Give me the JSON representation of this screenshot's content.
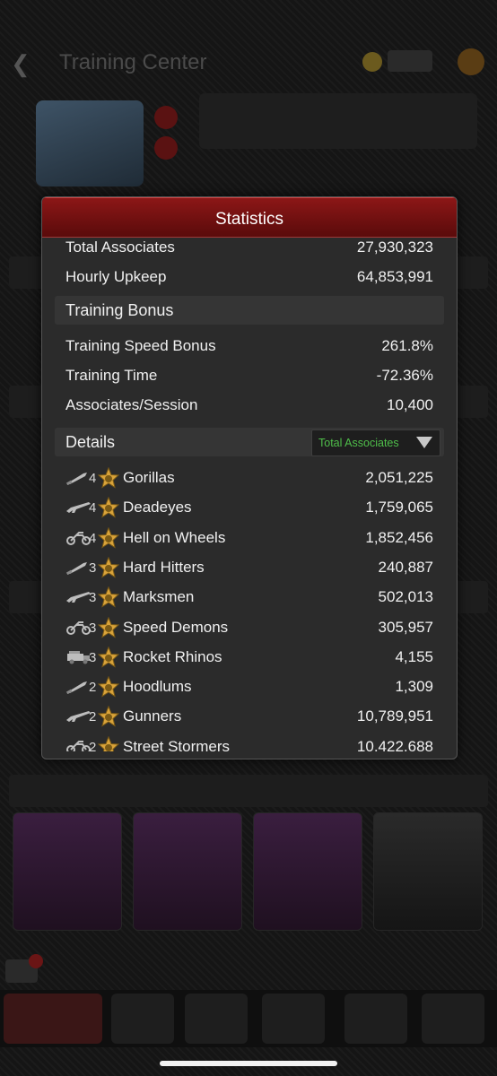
{
  "modal": {
    "title": "Statistics",
    "rows": [
      {
        "label": "Total Associates",
        "value": "27,930,323"
      },
      {
        "label": "Hourly Upkeep",
        "value": "64,853,991"
      }
    ],
    "training_bonus": {
      "title": "Training Bonus",
      "rows": [
        {
          "label": "Training Speed Bonus",
          "value": "261.8%"
        },
        {
          "label": "Training Time",
          "value": "-72.36%"
        },
        {
          "label": "Associates/Session",
          "value": "10,400"
        }
      ]
    },
    "details": {
      "title": "Details",
      "dropdown_selected": "Total Associates",
      "units": [
        {
          "tier": "4",
          "weapon_icon": "knife-icon",
          "name": "Gorillas",
          "count": "2,051,225"
        },
        {
          "tier": "4",
          "weapon_icon": "rifle-icon",
          "name": "Deadeyes",
          "count": "1,759,065"
        },
        {
          "tier": "4",
          "weapon_icon": "motorcycle-icon",
          "name": "Hell on Wheels",
          "count": "1,852,456"
        },
        {
          "tier": "3",
          "weapon_icon": "knife-icon",
          "name": "Hard Hitters",
          "count": "240,887"
        },
        {
          "tier": "3",
          "weapon_icon": "rifle-icon",
          "name": "Marksmen",
          "count": "502,013"
        },
        {
          "tier": "3",
          "weapon_icon": "motorcycle-icon",
          "name": "Speed Demons",
          "count": "305,957"
        },
        {
          "tier": "3",
          "weapon_icon": "truck-icon",
          "name": "Rocket Rhinos",
          "count": "4,155"
        },
        {
          "tier": "2",
          "weapon_icon": "knife-icon",
          "name": "Hoodlums",
          "count": "1,309"
        },
        {
          "tier": "2",
          "weapon_icon": "rifle-icon",
          "name": "Gunners",
          "count": "10,789,951"
        },
        {
          "tier": "2",
          "weapon_icon": "motorcycle-icon",
          "name": "Street Stormers",
          "count": "10,422,688"
        }
      ]
    }
  },
  "background": {
    "title": "Training Center"
  },
  "colors": {
    "title_bar": "#7a1111",
    "dropdown_text": "#4fbf4a",
    "star": "#d9a33a"
  }
}
